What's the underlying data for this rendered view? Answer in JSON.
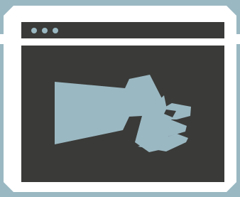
{
  "window": {
    "title_bar_dots": [
      "window-dot-1",
      "window-dot-2",
      "window-dot-3"
    ],
    "icon": "raised-fist-icon"
  },
  "colors": {
    "background": "#9ab8c2",
    "frame": "#ffffff",
    "panel": "#3a3a38",
    "accent": "#9ab8c2"
  }
}
